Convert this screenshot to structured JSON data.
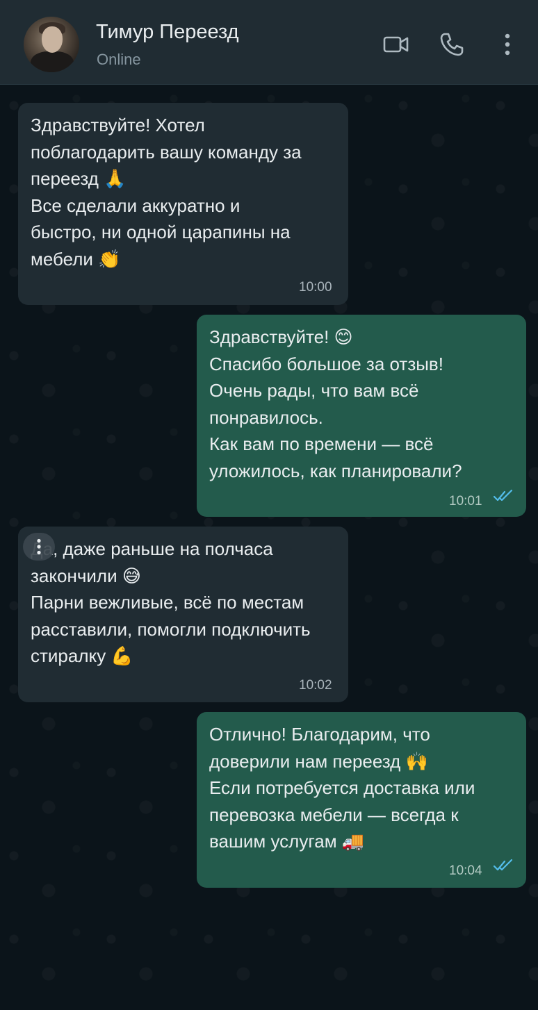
{
  "header": {
    "contact_name": "Тимур Переезд",
    "status": "Online",
    "icons": [
      "video-camera-icon",
      "phone-icon",
      "kebab-menu-icon"
    ]
  },
  "messages": [
    {
      "direction": "incoming",
      "text": "Здравствуйте! Хотел\nпоблагодарить вашу команду за\nпереезд 🙏\nВсе сделали аккуратно и\nбыстро, ни одной царапины на\nмебели 👏",
      "time": "10:00"
    },
    {
      "direction": "outgoing",
      "text": "Здравствуйте! 😊\nСпасибо большое за отзыв!\nОчень рады, что вам всё\nпонравилось.\nКак вам по времени — всё\nуложилось, как планировали?",
      "time": "10:01",
      "status": "read"
    },
    {
      "direction": "incoming",
      "text": "Да, даже раньше на полчаса\nзакончили 😅\nПарни вежливые, всё по местам\nрасставили, помогли подключить\nстиралку 💪",
      "time": "10:02"
    },
    {
      "direction": "outgoing",
      "text": "Отлично! Благодарим, что\nдоверили нам переезд 🙌\nЕсли потребуется доставка или\nперевозка мебели — всегда к\nвашим услугам 🚚",
      "time": "10:04",
      "status": "read"
    }
  ],
  "colors": {
    "header_bg": "#202c33",
    "chat_bg": "#0b141a",
    "incoming_bubble": "#202c33",
    "outgoing_bubble": "#235b4c",
    "read_ticks": "#53bdeb",
    "secondary_text": "#8696a0"
  }
}
